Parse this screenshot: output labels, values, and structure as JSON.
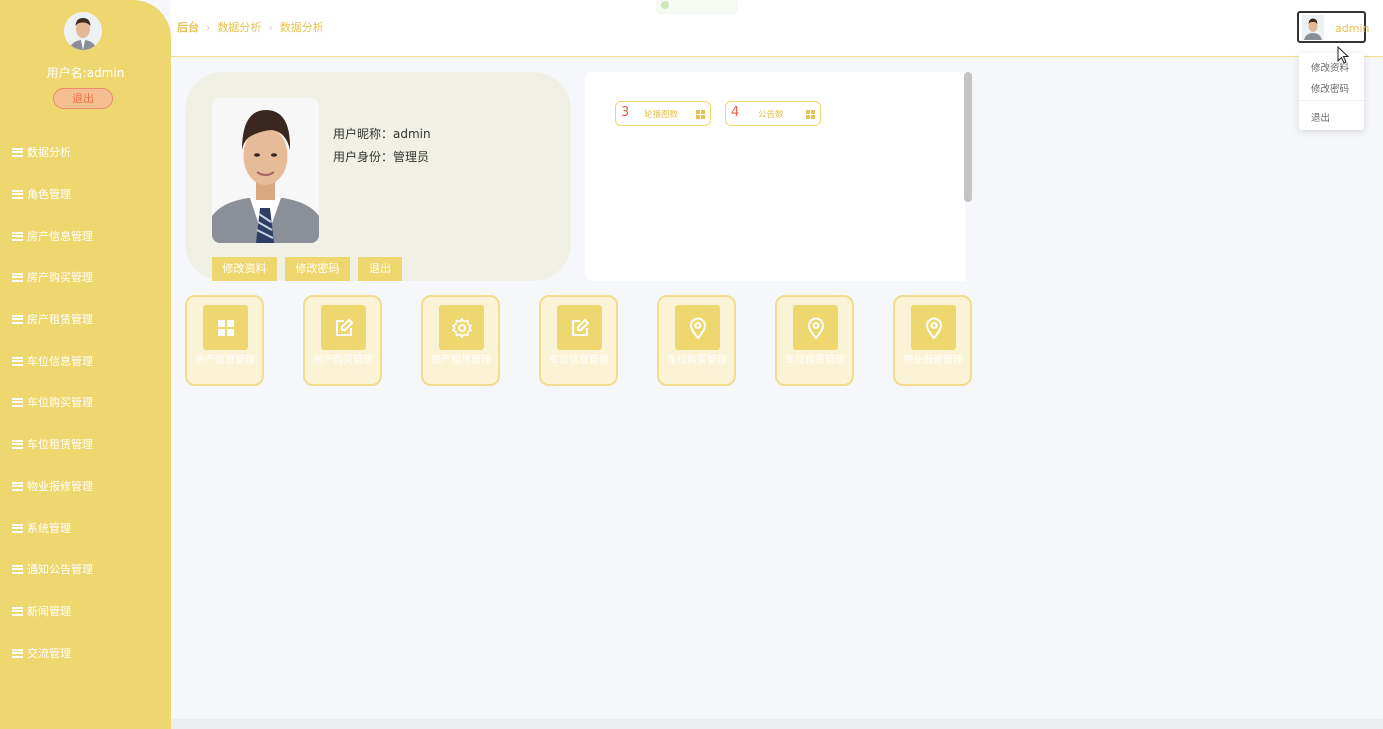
{
  "sidebar": {
    "username_label": "用户名:admin",
    "logout_label": "退出",
    "items": [
      {
        "label": "数据分析"
      },
      {
        "label": "角色管理"
      },
      {
        "label": "房产信息管理"
      },
      {
        "label": "房产购买管理"
      },
      {
        "label": "房产租赁管理"
      },
      {
        "label": "车位信息管理"
      },
      {
        "label": "车位购买管理"
      },
      {
        "label": "车位租赁管理"
      },
      {
        "label": "物业报修管理"
      },
      {
        "label": "系统管理"
      },
      {
        "label": "通知公告管理"
      },
      {
        "label": "新闻管理"
      },
      {
        "label": "交流管理"
      }
    ]
  },
  "header": {
    "breadcrumb": [
      "后台",
      "数据分析",
      "数据分析"
    ],
    "user_name": "admin"
  },
  "dropdown": {
    "items": [
      "修改资料",
      "修改密码",
      "退出"
    ]
  },
  "profile": {
    "nickname_label": "用户昵称：admin",
    "role_label": "用户身份：管理员",
    "buttons": [
      "修改资料",
      "修改密码",
      "退出"
    ]
  },
  "stats": [
    {
      "value": "3",
      "label": "轮播图数"
    },
    {
      "value": "4",
      "label": "公告数"
    }
  ],
  "tiles": [
    {
      "label": "房产信息管理",
      "icon": "grid-icon"
    },
    {
      "label": "房产购买管理",
      "icon": "edit-icon"
    },
    {
      "label": "房产租赁管理",
      "icon": "gear-icon"
    },
    {
      "label": "车位信息管理",
      "icon": "edit-icon"
    },
    {
      "label": "车位购买管理",
      "icon": "location-pin-icon"
    },
    {
      "label": "车位租赁管理",
      "icon": "location-pin-icon"
    },
    {
      "label": "物业报修管理",
      "icon": "location-pin-icon"
    }
  ],
  "colors": {
    "sidebar": "#efd76f",
    "accent": "#e6c34f",
    "tile_bg": "#faf3d6",
    "stat_number": "#e8604c"
  }
}
